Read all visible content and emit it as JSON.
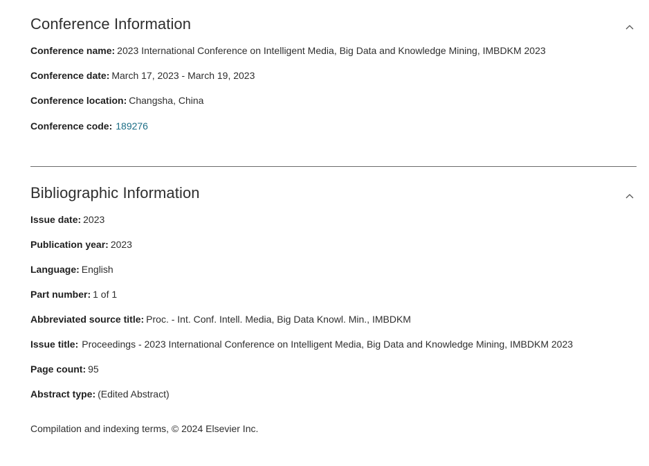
{
  "conference": {
    "title": "Conference Information",
    "fields": [
      {
        "label": "Conference name:",
        "value": "2023 International Conference on Intelligent Media, Big Data and Knowledge Mining, IMBDKM 2023"
      },
      {
        "label": "Conference date:",
        "value": "March 17, 2023 - March 19, 2023"
      },
      {
        "label": "Conference location:",
        "value": "Changsha, China"
      },
      {
        "label": "Conference code:",
        "value": "189276"
      }
    ]
  },
  "bibliographic": {
    "title": "Bibliographic Information",
    "fields": [
      {
        "label": "Issue date:",
        "value": "2023"
      },
      {
        "label": "Publication year:",
        "value": "2023"
      },
      {
        "label": "Language:",
        "value": "English"
      },
      {
        "label": "Part number:",
        "value": "1 of 1"
      },
      {
        "label": "Abbreviated source title:",
        "value": "Proc. - Int. Conf. Intell. Media, Big Data Knowl. Min., IMBDKM"
      },
      {
        "label": "Issue title:",
        "value": "Proceedings - 2023 International Conference on Intelligent Media, Big Data and Knowledge Mining, IMBDKM 2023"
      },
      {
        "label": "Page count:",
        "value": "95"
      },
      {
        "label": "Abstract type:",
        "value": "(Edited Abstract)"
      }
    ]
  },
  "footer": {
    "text": "Compilation and indexing terms, © 2024 Elsevier Inc."
  },
  "icons": {
    "collapse": "chevron-up-icon"
  },
  "colors": {
    "link": "#1b6d85",
    "divider": "#6a6a6a"
  }
}
